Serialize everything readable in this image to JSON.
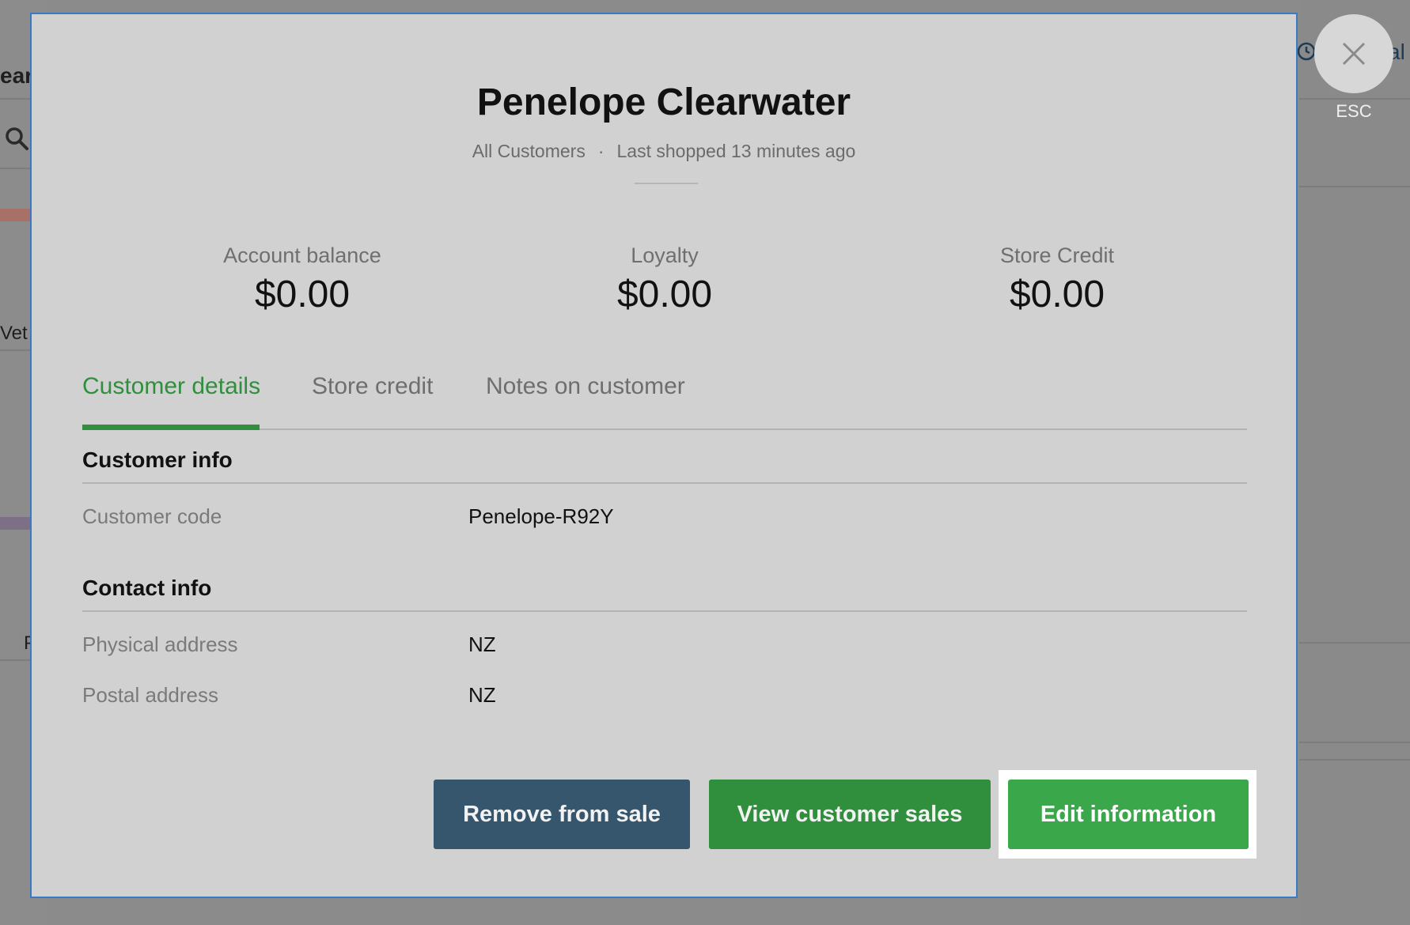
{
  "background": {
    "search_text": "ear",
    "thumb1_text": "Vet",
    "thumb2_text": "P",
    "right_header_text": "al"
  },
  "close": {
    "esc_label": "ESC"
  },
  "customer": {
    "name": "Penelope Clearwater",
    "group": "All Customers",
    "separator": "·",
    "last_shopped": "Last shopped 13 minutes ago"
  },
  "stats": [
    {
      "label": "Account balance",
      "value": "$0.00"
    },
    {
      "label": "Loyalty",
      "value": "$0.00"
    },
    {
      "label": "Store Credit",
      "value": "$0.00"
    }
  ],
  "tabs": [
    {
      "label": "Customer details",
      "active": true
    },
    {
      "label": "Store credit",
      "active": false
    },
    {
      "label": "Notes on customer",
      "active": false
    }
  ],
  "customer_info": {
    "title": "Customer info",
    "rows": [
      {
        "label": "Customer code",
        "value": "Penelope-R92Y"
      }
    ]
  },
  "contact_info": {
    "title": "Contact info",
    "rows": [
      {
        "label": "Physical address",
        "value": "NZ"
      },
      {
        "label": "Postal address",
        "value": "NZ"
      }
    ]
  },
  "actions": {
    "remove": "Remove from sale",
    "view_sales": "View customer sales",
    "edit": "Edit information"
  },
  "colors": {
    "accent_green": "#2f8f3d",
    "button_dark_blue": "#36566e",
    "button_green": "#3aa84a",
    "modal_border": "#3a7ac4"
  }
}
